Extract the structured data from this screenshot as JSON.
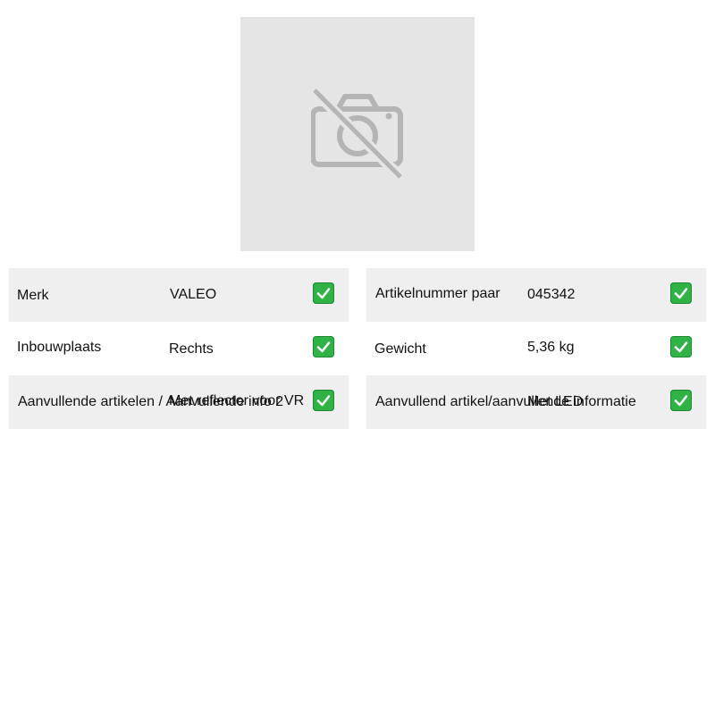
{
  "product": {
    "image_icon": "camera-off-icon"
  },
  "specs": [
    {
      "label": "Merk",
      "value": "VALEO",
      "check_icon": "checkmark-icon"
    },
    {
      "label": "Artikelnummer paar",
      "value": "045342",
      "check_icon": "checkmark-icon"
    },
    {
      "label": "Inbouwplaats",
      "value": "Rechts",
      "check_icon": "checkmark-icon"
    },
    {
      "label": "Gewicht",
      "value": "5,36 kg",
      "check_icon": "checkmark-icon"
    },
    {
      "label": "Aanvullende artikelen / Aanvullende info 2",
      "value": "Met reflector voor VR",
      "check_icon": "checkmark-icon"
    },
    {
      "label": "Aanvullend artikel/aanvullende informatie",
      "value": "Met LED",
      "check_icon": "checkmark-icon"
    }
  ],
  "colors": {
    "row_shade": "#efefef",
    "photo_bg": "#e5e5e5",
    "icon_gray": "#b5b5b5",
    "check_green": "#2fb344"
  }
}
